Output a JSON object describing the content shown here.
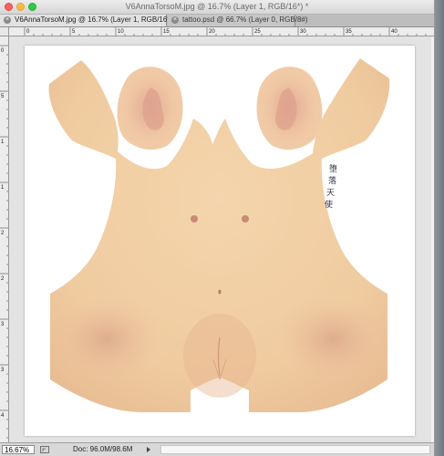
{
  "window": {
    "title": "V6AnnaTorsoM.jpg @ 16.7% (Layer 1, RGB/16*) *"
  },
  "tabs": [
    {
      "label": "V6AnnaTorsoM.jpg @ 16.7% (Layer 1, RGB/16*) *",
      "active": true
    },
    {
      "label": "tattoo.psd @ 66.7% (Layer 0, RGB/8#)",
      "active": false
    }
  ],
  "ruler_top": {
    "labels": [
      "0",
      "5",
      "10",
      "15",
      "20",
      "25",
      "30",
      "35",
      "40"
    ]
  },
  "ruler_left": {
    "labels": [
      "0",
      "5",
      "1",
      "1",
      "2",
      "2",
      "3",
      "3",
      "4"
    ]
  },
  "canvas": {
    "tattoo_text": [
      "堕",
      "落",
      "天",
      "使"
    ],
    "skin_color": "#f2cfa5",
    "shadow_color": "#dba986",
    "nipple_color": "#c98b76",
    "ear_inner_color": "#d69a8a"
  },
  "status": {
    "zoom": "16.67%",
    "doc_info": "Doc: 96.0M/98.6M"
  },
  "colors": {
    "chrome": "#dcdcdc",
    "tab_active": "#e2e2e2",
    "pasteboard": "#e3e3e3",
    "close_button": "#fc605c",
    "minimize_button": "#fdbc40",
    "maximize_button": "#34c84a"
  }
}
